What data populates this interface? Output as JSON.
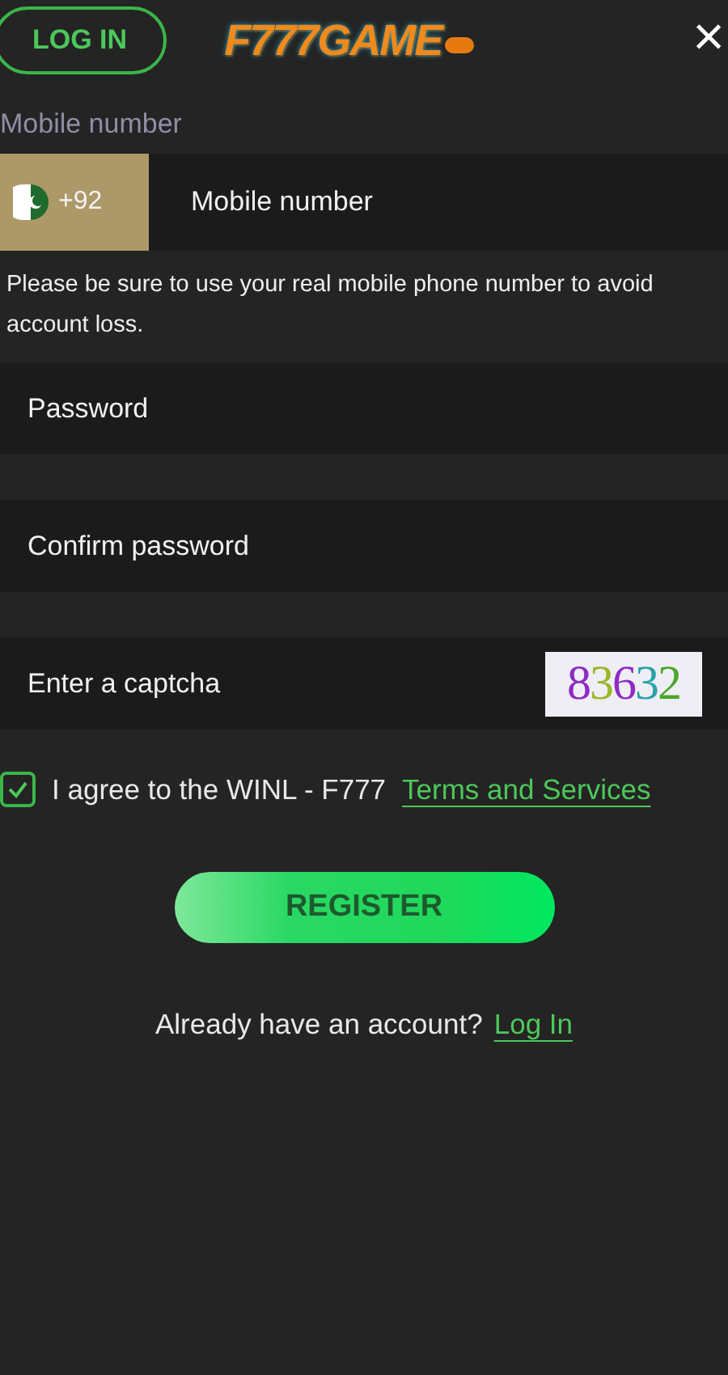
{
  "header": {
    "login_button": "LOG IN",
    "logo": "F777GAME",
    "close": "×"
  },
  "phone": {
    "label": "Mobile number",
    "country_code": "+92",
    "placeholder": "Mobile number",
    "note": "Please be sure to use your real mobile phone number to avoid account loss."
  },
  "fields": [
    {
      "kind": "password",
      "placeholder": "Password"
    },
    {
      "kind": "password",
      "placeholder": "Confirm password"
    },
    {
      "kind": "captcha",
      "placeholder": "Enter a captcha",
      "captcha": "83632"
    }
  ],
  "agreement": {
    "checked": true,
    "text": "I agree to the WINL - F777",
    "link": "Terms and Services"
  },
  "register_button": "REGISTER",
  "footer": {
    "text": "Already have an account?",
    "link": "Log In"
  }
}
